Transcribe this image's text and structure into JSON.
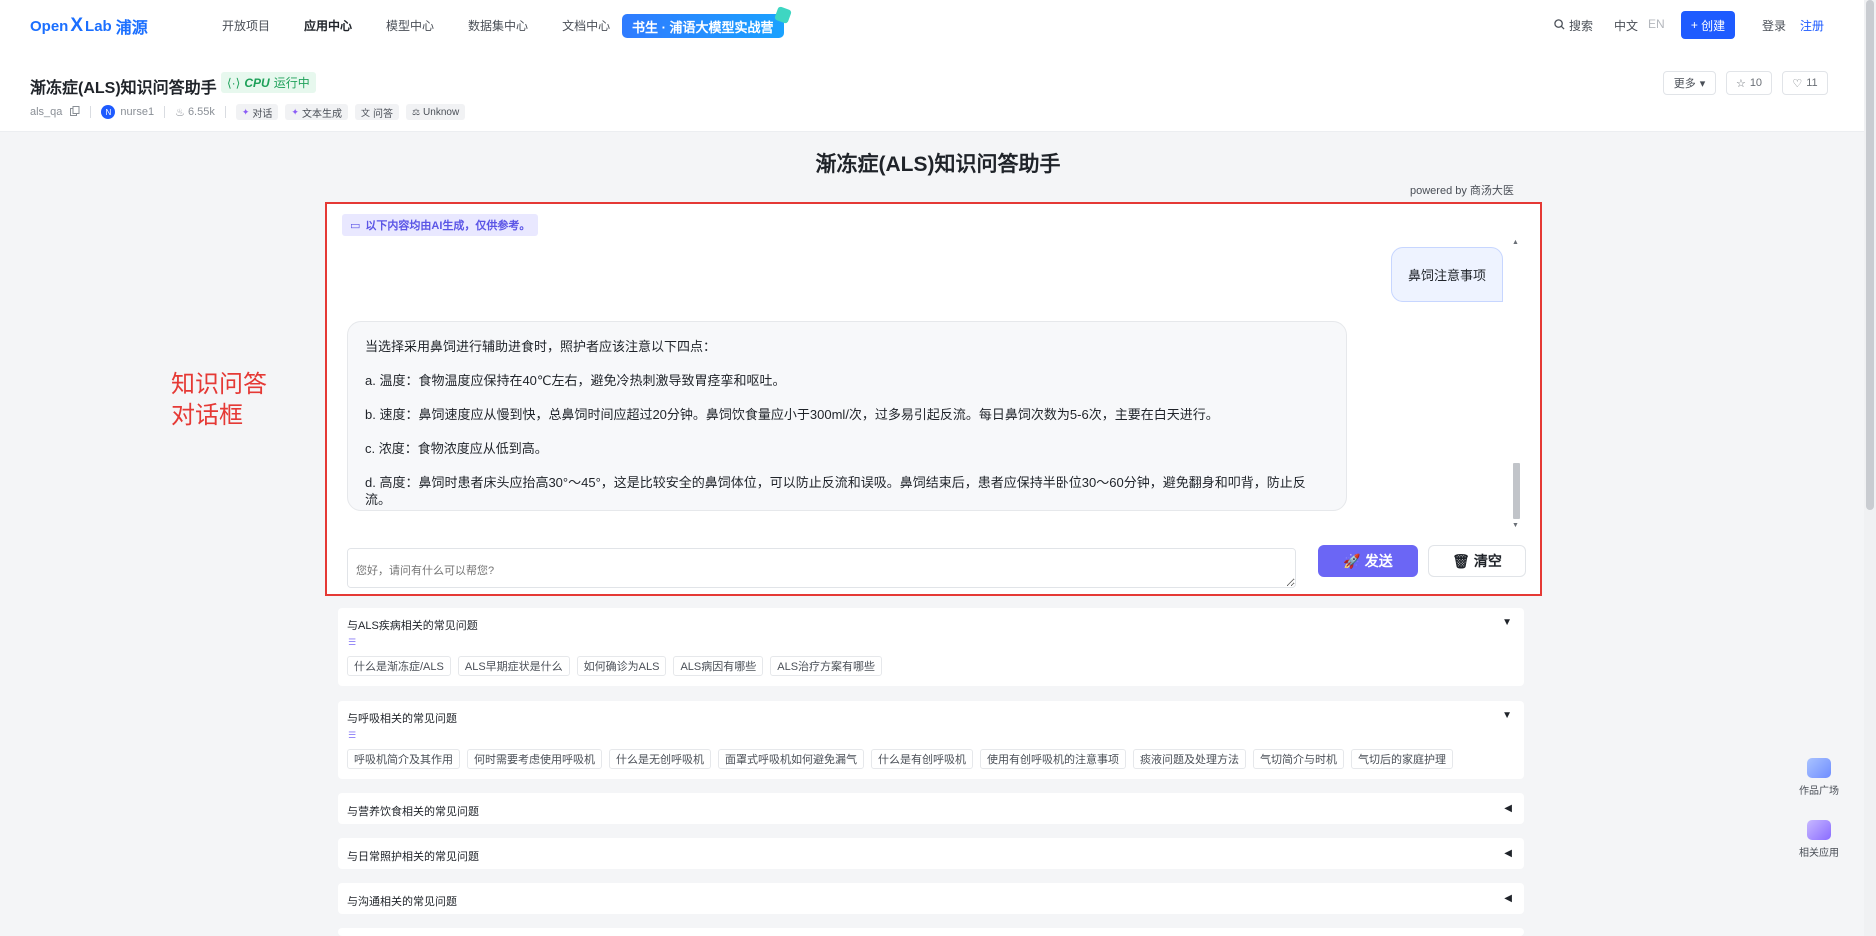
{
  "nav": {
    "logo_en": "Open",
    "logo_x": "X",
    "logo_lab": "Lab",
    "logo_cn": "浦源",
    "links": [
      "开放项目",
      "应用中心",
      "模型中心",
      "数据集中心",
      "文档中心"
    ],
    "promo": "书生 · 浦语大模型实战营",
    "search": "搜索",
    "lang_zh": "中文",
    "lang_en": "EN",
    "create": "创建",
    "login": "登录",
    "register": "注册"
  },
  "app": {
    "title": "渐冻症(ALS)知识问答助手",
    "status_cpu": "CPU",
    "status_text": "运行中",
    "repo": "als_qa",
    "author_initial": "N",
    "author": "nurse1",
    "views": "6.55k",
    "tags": [
      "对话",
      "文本生成",
      "问答",
      "Unknow"
    ],
    "more": "更多",
    "stars": "10",
    "likes": "11"
  },
  "main": {
    "title": "渐冻症(ALS)知识问答助手",
    "powered": "powered by 商汤大医"
  },
  "chat": {
    "notice": "以下内容均由AI生成，仅供参考。",
    "user_message": "鼻饲注意事项",
    "bot_lines": [
      "当选择采用鼻饲进行辅助进食时，照护者应该注意以下四点：",
      "a. 温度：食物温度应保持在40℃左右，避免冷热刺激导致胃痉挛和呕吐。",
      "b. 速度：鼻饲速度应从慢到快，总鼻饲时间应超过20分钟。鼻饲饮食量应小于300ml/次，过多易引起反流。每日鼻饲次数为5-6次，主要在白天进行。",
      "c. 浓度：食物浓度应从低到高。",
      "d. 高度：鼻饲时患者床头应抬高30°～45°，这是比较安全的鼻饲体位，可以防止反流和误吸。鼻饲结束后，患者应保持半卧位30～60分钟，避免翻身和叩背，防止反流。"
    ],
    "input_placeholder": "您好，请问有什么可以帮您?",
    "send": "发送",
    "clear": "清空"
  },
  "annotation": {
    "line1": "知识问答",
    "line2": "对话框"
  },
  "faq": [
    {
      "title": "与ALS疾病相关的常见问题",
      "expanded": true,
      "items": [
        "什么是渐冻症/ALS",
        "ALS早期症状是什么",
        "如何确诊为ALS",
        "ALS病因有哪些",
        "ALS治疗方案有哪些"
      ]
    },
    {
      "title": "与呼吸相关的常见问题",
      "expanded": true,
      "items": [
        "呼吸机简介及其作用",
        "何时需要考虑使用呼吸机",
        "什么是无创呼吸机",
        "面罩式呼吸机如何避免漏气",
        "什么是有创呼吸机",
        "使用有创呼吸机的注意事项",
        "痰液问题及处理方法",
        "气切简介与时机",
        "气切后的家庭护理"
      ]
    },
    {
      "title": "与营养饮食相关的常见问题",
      "expanded": false,
      "items": []
    },
    {
      "title": "与日常照护相关的常见问题",
      "expanded": false,
      "items": []
    },
    {
      "title": "与沟通相关的常见问题",
      "expanded": false,
      "items": []
    }
  ],
  "float": {
    "gallery": "作品广场",
    "related": "相关应用"
  },
  "colors": {
    "brand": "#1e5bff",
    "accent_purple": "#6b66f5",
    "annotation_red": "#e53935",
    "status_green": "#1fa15a"
  }
}
